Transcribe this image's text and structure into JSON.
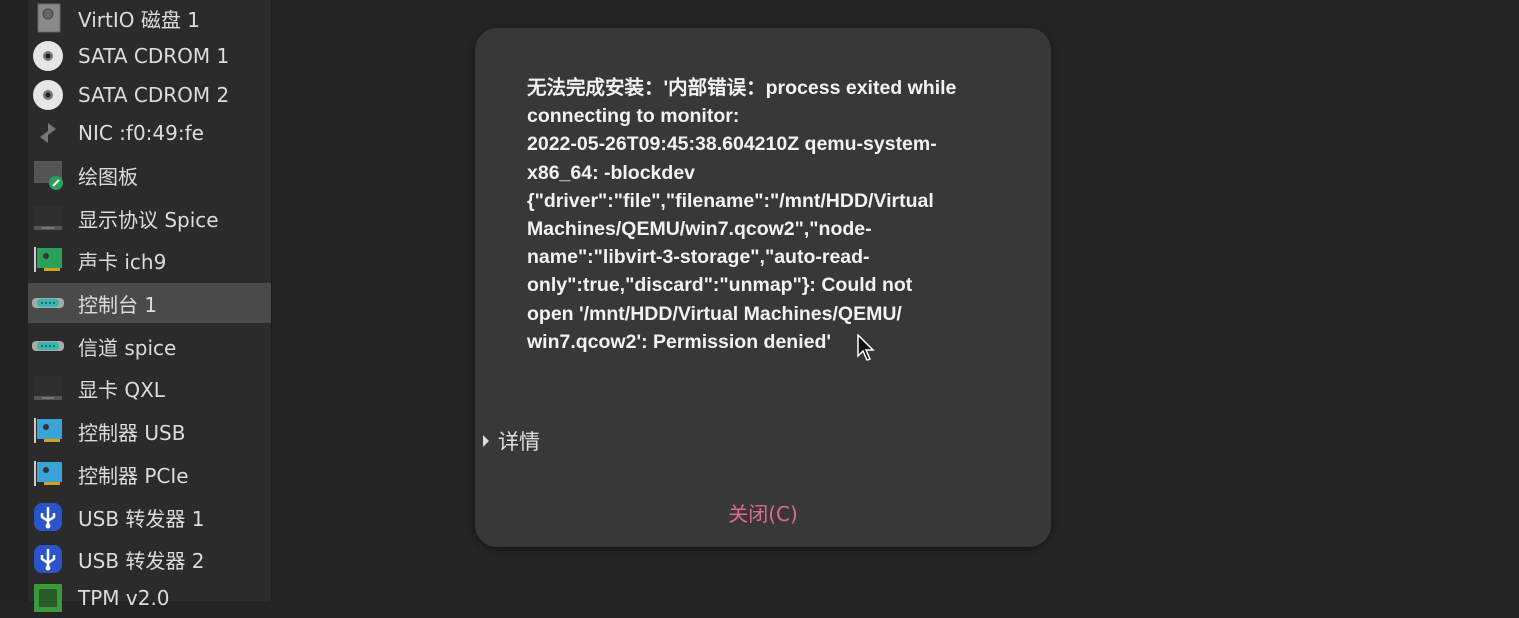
{
  "sidebar": {
    "items": [
      {
        "label": "VirtIO 磁盘 1",
        "icon": "hard-disk-icon"
      },
      {
        "label": "SATA CDROM 1",
        "icon": "cdrom-icon"
      },
      {
        "label": "SATA CDROM 2",
        "icon": "cdrom-icon"
      },
      {
        "label": "NIC :f0:49:fe",
        "icon": "network-icon"
      },
      {
        "label": "绘图板",
        "icon": "tablet-icon"
      },
      {
        "label": "显示协议 Spice",
        "icon": "display-icon"
      },
      {
        "label": "声卡 ich9",
        "icon": "sound-card-icon"
      },
      {
        "label": "控制台 1",
        "icon": "serial-port-icon",
        "selected": true
      },
      {
        "label": "信道 spice",
        "icon": "serial-port-icon"
      },
      {
        "label": "显卡 QXL",
        "icon": "display-icon"
      },
      {
        "label": "控制器 USB",
        "icon": "pci-card-icon"
      },
      {
        "label": "控制器 PCIe",
        "icon": "pci-card-icon"
      },
      {
        "label": "USB 转发器 1",
        "icon": "usb-icon"
      },
      {
        "label": "USB 转发器 2",
        "icon": "usb-icon"
      },
      {
        "label": "TPM v2.0",
        "icon": "tpm-chip-icon"
      }
    ]
  },
  "dialog": {
    "message_lines": [
      "无法完成安装：'内部错误：process exited while",
      "connecting to monitor:",
      "2022-05-26T09:45:38.604210Z qemu-system-",
      "x86_64: -blockdev",
      "{\"driver\":\"file\",\"filename\":\"/mnt/HDD/Virtual",
      "Machines/QEMU/win7.qcow2\",\"node-",
      "name\":\"libvirt-3-storage\",\"auto-read-",
      "only\":true,\"discard\":\"unmap\"}: Could not",
      "open '/mnt/HDD/Virtual Machines/QEMU/",
      "win7.qcow2': Permission denied'"
    ],
    "details_label": "详情",
    "close_label": "关闭(C)"
  },
  "colors": {
    "accent": "#e0679a",
    "dialog_bg": "#383838",
    "selected_row": "#4a4a4a"
  }
}
